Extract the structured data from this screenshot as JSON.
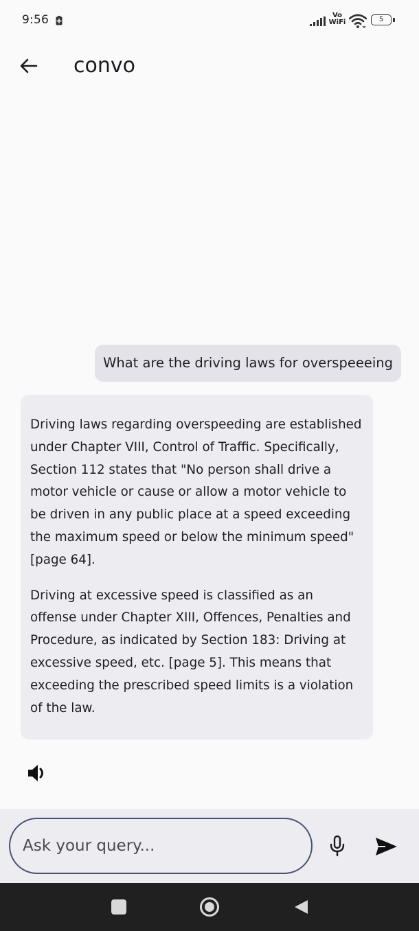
{
  "status_bar": {
    "time": "9:56",
    "vowifi_top": "Vo",
    "vowifi_bottom": "WiFi",
    "battery_level": "5"
  },
  "app_bar": {
    "title": "convo"
  },
  "chat": {
    "messages": [
      {
        "role": "user",
        "text": "What are the driving laws for overspeeeing"
      },
      {
        "role": "assistant",
        "paragraphs": [
          "Driving laws regarding overspeeding are established under Chapter VIII, Control of Traffic. Specifically, Section 112 states that \"No person shall drive a motor vehicle or cause or allow a motor vehicle to be driven in any public place at a speed exceeding the maximum speed or below the minimum speed\" [page 64].",
          "Driving at excessive speed is classified as an offense under Chapter XIII, Offences, Penalties and Procedure, as indicated by Section 183: Driving at excessive speed, etc. [page 5]. This means that exceeding the prescribed speed limits is a violation of the law."
        ]
      }
    ]
  },
  "input": {
    "placeholder": "Ask your query...",
    "value": ""
  },
  "icons": {
    "back": "arrow-left-icon",
    "speaker": "speaker-icon",
    "mic": "microphone-icon",
    "send": "send-icon"
  },
  "colors": {
    "input_border": "#4a5272",
    "input_area_bg": "#ececf1",
    "user_bubble_bg": "#e4e3ea",
    "bot_bubble_bg": "#ececf1",
    "nav_bar_bg": "#202020"
  }
}
